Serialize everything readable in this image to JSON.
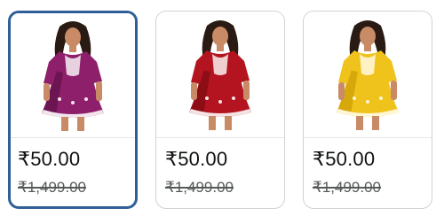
{
  "variants": [
    {
      "color_name": "magenta",
      "dress_color": "#8e1f6b",
      "dress_shade": "#6d1552",
      "embroidery_color": "#f2e6ee",
      "price": "₹50.00",
      "mrp": "₹1,499.00",
      "selected": true
    },
    {
      "color_name": "red",
      "dress_color": "#b3141f",
      "dress_shade": "#8d0d16",
      "embroidery_color": "#f5e3e3",
      "price": "₹50.00",
      "mrp": "₹1,499.00",
      "selected": false
    },
    {
      "color_name": "yellow",
      "dress_color": "#f0c21c",
      "dress_shade": "#d7a80c",
      "embroidery_color": "#fff6d6",
      "price": "₹50.00",
      "mrp": "₹1,499.00",
      "selected": false
    }
  ],
  "colors": {
    "selected_border": "#2f5f97",
    "card_border": "#cfd3d6",
    "price_text": "#0f1111",
    "mrp_text": "#565959"
  }
}
